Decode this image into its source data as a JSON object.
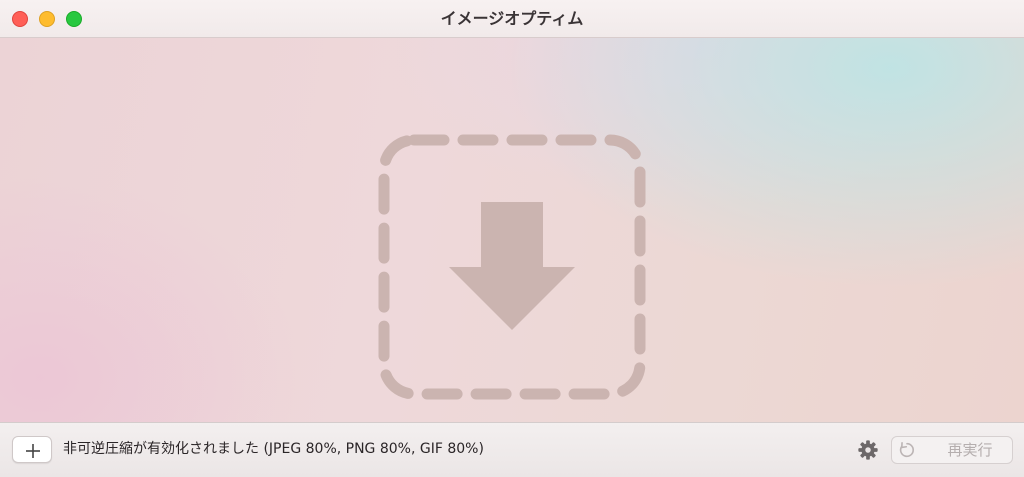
{
  "window": {
    "title": "イメージオプティム"
  },
  "dropzone": {
    "icon": "download-arrow-icon"
  },
  "toolbar": {
    "add_label": "+",
    "status": "非可逆圧縮が有効化されました (JPEG 80%, PNG 80%, GIF 80%)",
    "rerun_label": "再実行",
    "settings_icon": "gear-icon",
    "refresh_icon": "refresh-icon"
  },
  "colors": {
    "close": "#ff5f57",
    "minimize": "#febc2e",
    "zoom": "#28c840",
    "dropzone_mark": "#cbb4b0"
  }
}
